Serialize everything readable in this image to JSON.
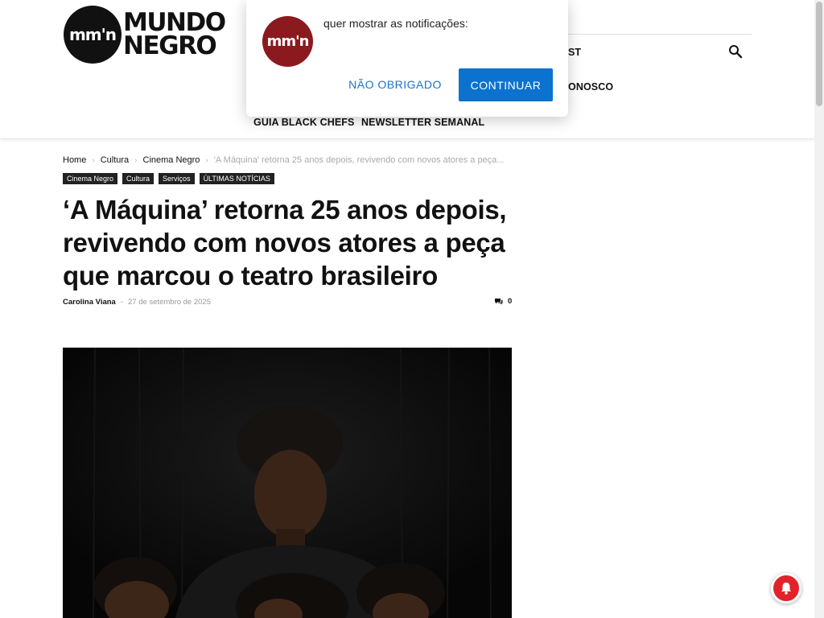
{
  "header": {
    "logo": {
      "mark": "mm'n",
      "line1": "MUNDO",
      "line2": "NEGRO"
    },
    "nav": {
      "item_partial_1": "ST",
      "item_partial_2": "ONOSCO",
      "guia": "GUIA BLACK CHEFS",
      "newsletter": "NEWSLETTER SEMANAL"
    },
    "search_icon": "search-icon"
  },
  "popup": {
    "logo_mark": "mm'n",
    "message": "quer mostrar as notificações:",
    "decline_label": "NÃO OBRIGADO",
    "accept_label": "CONTINUAR"
  },
  "breadcrumb": {
    "items": [
      "Home",
      "Cultura",
      "Cinema Negro"
    ],
    "current": "'A Máquina' retorna 25 anos depois, revivendo com novos atores a peça..."
  },
  "tags": [
    "Cinema Negro",
    "Cultura",
    "Serviços",
    "ÚLTIMAS NOTÍCIAS"
  ],
  "article": {
    "title": "‘A Máquina’ retorna 25 anos depois, revivendo com novos atores a peça que marcou o teatro brasileiro",
    "author": "Carolina Viana",
    "separator": "-",
    "date": "27 de setembro de 2025",
    "comments_count": "0"
  },
  "colors": {
    "accent_blue": "#0b72cf",
    "brand_red": "#8b1a1f",
    "fab_red": "#e0232a"
  }
}
